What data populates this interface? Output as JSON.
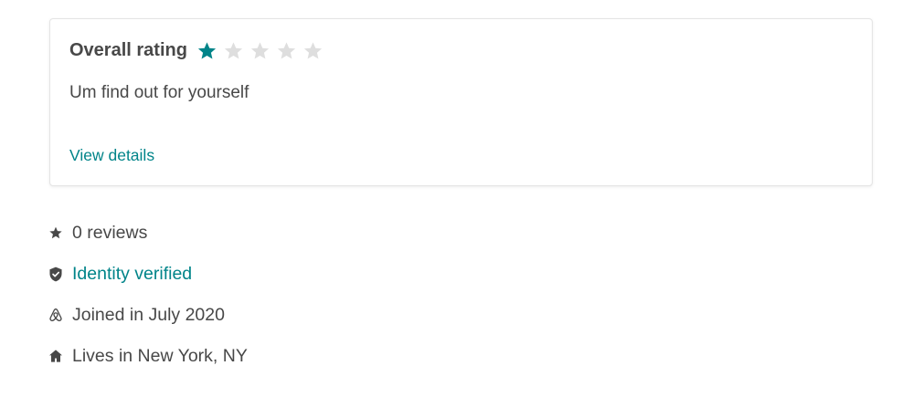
{
  "review": {
    "title": "Overall rating",
    "rating": 1,
    "max_rating": 5,
    "text": "Um find out for yourself",
    "view_details_label": "View details"
  },
  "profile": {
    "reviews_label": "0 reviews",
    "identity_label": "Identity verified",
    "joined_label": "Joined in July 2020",
    "lives_label": "Lives in New York, NY"
  },
  "colors": {
    "accent": "#008489",
    "text": "#484848",
    "star_empty": "#dedede",
    "border": "#e4e4e4"
  },
  "icons": {
    "reviews": "star-icon",
    "identity": "shield-check-icon",
    "joined": "airbnb-logo-icon",
    "lives": "house-icon"
  }
}
